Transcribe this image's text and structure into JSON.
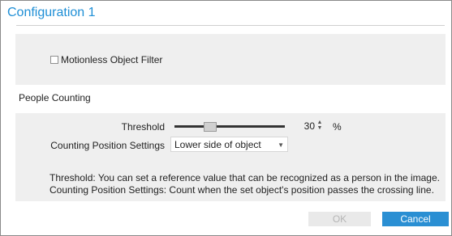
{
  "dialog": {
    "title": "Configuration 1"
  },
  "motionless": {
    "checkbox_label": "Motionless Object Filter",
    "checked": false
  },
  "people_counting": {
    "section_label": "People Counting",
    "threshold_label": "Threshold",
    "threshold_value": "30",
    "threshold_unit": "%",
    "threshold_slider_fraction": 0.3,
    "position_label": "Counting Position Settings",
    "position_value": "Lower side of object",
    "help_line1": "Threshold: You can set a reference value that can be recognized as a person in the image.",
    "help_line2": "Counting Position Settings: Count when the set object's position passes the crossing line."
  },
  "buttons": {
    "ok": "OK",
    "cancel": "Cancel"
  },
  "colors": {
    "accent": "#2a8fd3",
    "title": "#1f8fd6",
    "panel": "#efefef"
  }
}
